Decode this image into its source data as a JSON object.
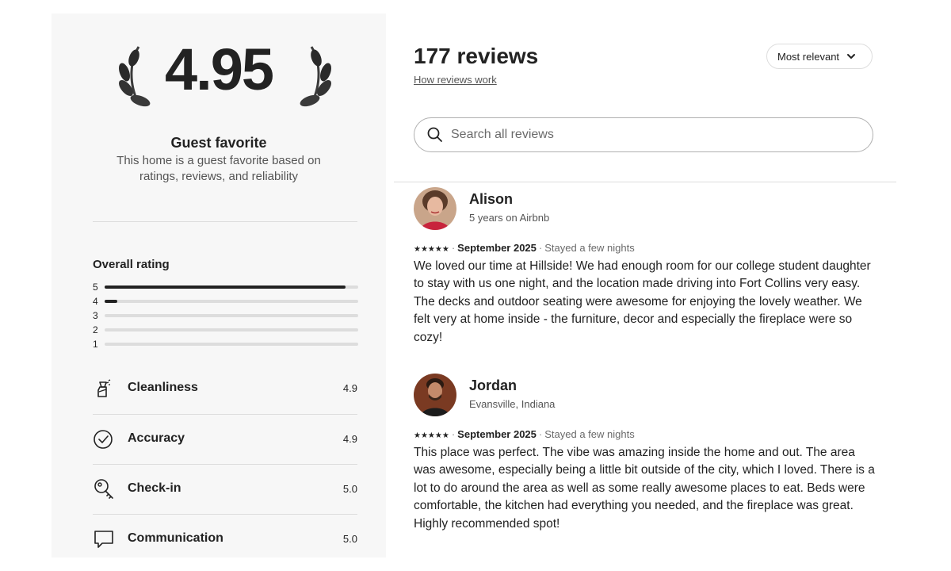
{
  "summary": {
    "rating": "4.95",
    "badge_title": "Guest favorite",
    "badge_subtitle": "This home is a guest favorite based on ratings, reviews, and reliability"
  },
  "overall": {
    "title": "Overall rating",
    "distribution": [
      {
        "star": "5",
        "fraction": 0.95
      },
      {
        "star": "4",
        "fraction": 0.05
      },
      {
        "star": "3",
        "fraction": 0
      },
      {
        "star": "2",
        "fraction": 0
      },
      {
        "star": "1",
        "fraction": 0
      }
    ]
  },
  "categories": [
    {
      "label": "Cleanliness",
      "value": "4.9",
      "icon": "spray-bottle-icon"
    },
    {
      "label": "Accuracy",
      "value": "4.9",
      "icon": "check-circle-icon"
    },
    {
      "label": "Check-in",
      "value": "5.0",
      "icon": "key-icon"
    },
    {
      "label": "Communication",
      "value": "5.0",
      "icon": "chat-bubble-icon"
    }
  ],
  "reviews_header": {
    "count_label": "177 reviews",
    "how_link": "How reviews work",
    "sort_label": "Most relevant"
  },
  "search": {
    "placeholder": "Search all reviews",
    "value": ""
  },
  "reviews": [
    {
      "name": "Alison",
      "meta": "5 years on Airbnb",
      "stars": "★★★★★",
      "rating": 5,
      "date": "September 2025",
      "stay": "Stayed a few nights",
      "text": "We loved our time at Hillside! We had enough room for our college student daughter to stay with us one night, and the location made driving into Fort Collins very easy. The decks and outdoor seating were awesome for enjoying the lovely weather. We felt very at home inside - the furniture, decor and especially the fireplace were so cozy!"
    },
    {
      "name": "Jordan",
      "meta": "Evansville, Indiana",
      "stars": "★★★★★",
      "rating": 5,
      "date": "September 2025",
      "stay": "Stayed a few nights",
      "text": "This place was perfect. The vibe was amazing inside the home and out.  The area was awesome, especially being a little bit outside of the city, which I loved. There is a lot to do around the area as well as some really awesome places to eat. Beds were comfortable, the kitchen had everything you needed, and the fireplace was great. Highly recommended spot!"
    }
  ],
  "colors": {
    "panel_bg": "#f7f7f7",
    "text": "#222222",
    "muted": "#6a6a6a",
    "divider": "#dddddd"
  }
}
